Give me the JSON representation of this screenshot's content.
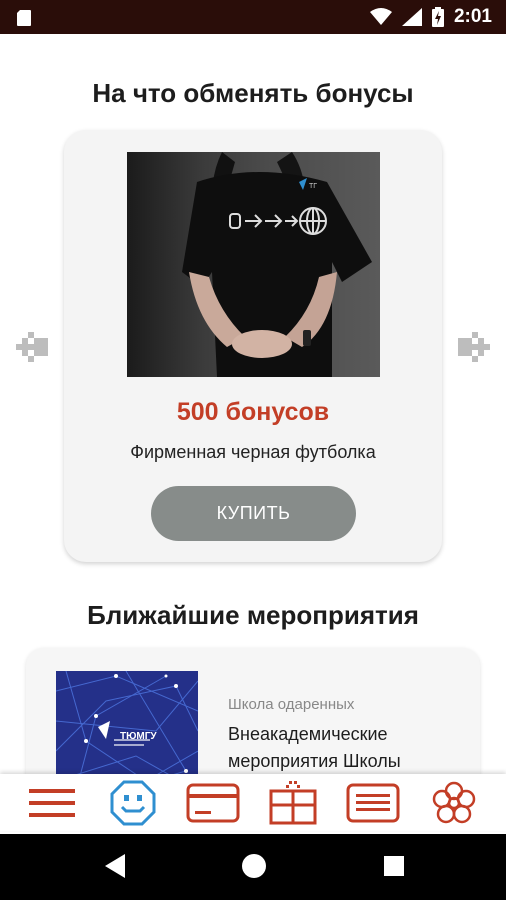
{
  "status_bar": {
    "time": "2:01"
  },
  "rewards": {
    "title": "На что обменять бонусы",
    "item": {
      "price": "500 бонусов",
      "name": "Фирменная черная футболка",
      "buy_label": "КУПИТЬ"
    }
  },
  "events": {
    "title": "Ближайшие мероприятия",
    "item": {
      "category": "Школа одаренных",
      "title": "Внеакадемические мероприятия Школы",
      "thumb_brand": "ТЮМГУ"
    }
  },
  "bottom_nav": {
    "items": [
      "menu-icon",
      "smiley-icon",
      "card-icon",
      "gift-icon",
      "list-icon",
      "flower-icon"
    ],
    "accent_color": "#c33e26"
  },
  "colors": {
    "status_bar": "#2a0d09",
    "price": "#c33e26",
    "buy_button": "#878c8a"
  }
}
